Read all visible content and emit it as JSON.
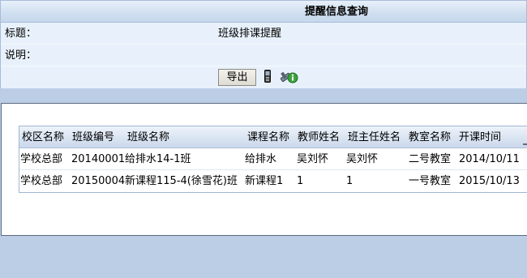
{
  "query_panel": {
    "title": "提醒信息查询",
    "fields": [
      {
        "label": "标题：",
        "value": "班级排课提醒"
      },
      {
        "label": "说明：",
        "value": ""
      }
    ],
    "export_label": "导出",
    "icons": [
      "mobile-phone-icon",
      "tools-info-icon"
    ]
  },
  "grid": {
    "columns": [
      "校区名称",
      "班级编号",
      "班级名称",
      "课程名称",
      "教师姓名",
      "班主任姓名",
      "教室名称",
      "开课时间"
    ],
    "rows": [
      [
        "学校总部",
        "20140001",
        "给排水14-1班",
        "给排水",
        "吴刘怀",
        "吴刘怀",
        "二号教室",
        "2014/10/11"
      ],
      [
        "学校总部",
        "20150004",
        "新课程115-4(徐雪花)班",
        "新课程1",
        "1",
        "1",
        "一号教室",
        "2015/10/13"
      ]
    ]
  }
}
